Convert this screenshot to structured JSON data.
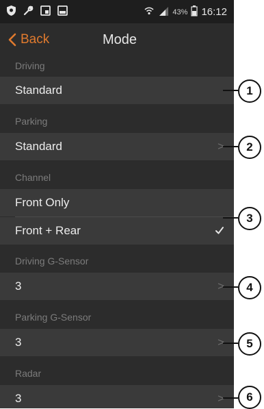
{
  "status_bar": {
    "icons_left": [
      "shield-icon",
      "wrench-icon",
      "screenshot-icon",
      "image-icon"
    ],
    "wifi": "wifi-icon",
    "signal": "signal-icon",
    "battery_percent": "43%",
    "time": "16:12"
  },
  "nav": {
    "back_label": "Back",
    "title": "Mode"
  },
  "sections": [
    {
      "label": "Driving",
      "rows": [
        {
          "value": "Standard",
          "chevron": false
        }
      ]
    },
    {
      "label": "Parking",
      "rows": [
        {
          "value": "Standard",
          "chevron": true
        }
      ]
    },
    {
      "label": "Channel",
      "rows": [
        {
          "value": "Front Only",
          "checked": false
        },
        {
          "value": "Front + Rear",
          "checked": true
        }
      ]
    },
    {
      "label": "Driving G-Sensor",
      "rows": [
        {
          "value": "3",
          "chevron": true
        }
      ]
    },
    {
      "label": "Parking G-Sensor",
      "rows": [
        {
          "value": "3",
          "chevron": true
        }
      ]
    },
    {
      "label": "Radar",
      "rows": [
        {
          "value": "3",
          "chevron": true
        }
      ]
    }
  ],
  "chevron_glyph": ">",
  "callouts": [
    "1",
    "2",
    "3",
    "4",
    "5",
    "6"
  ],
  "colors": {
    "accent": "#e07a2e",
    "background": "#2c2c2c",
    "row": "#3a3a3a",
    "label": "#7c7c7c"
  }
}
